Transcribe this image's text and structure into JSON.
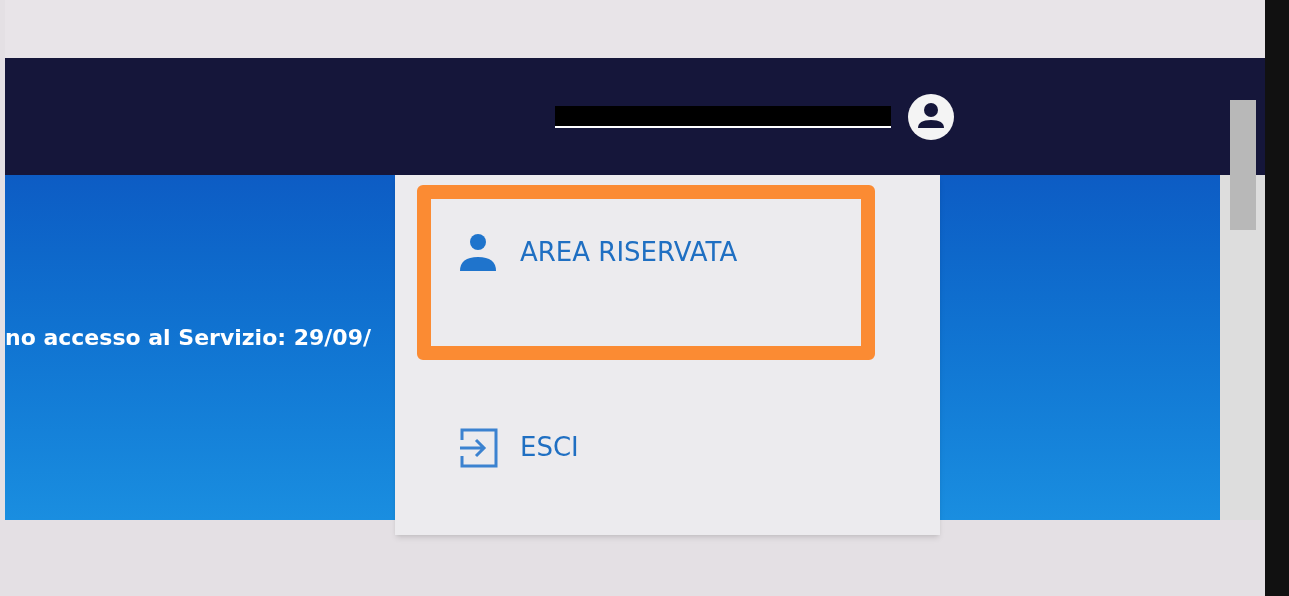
{
  "header": {
    "user_name": {
      "redacted": true
    }
  },
  "banner": {
    "last_access": "no accesso al Servizio:  29/09/"
  },
  "user_menu": {
    "open": true,
    "items": [
      {
        "kind": "profile",
        "label": "AREA RISERVATA",
        "highlighted": true
      },
      {
        "kind": "logout",
        "label": "ESCI",
        "highlighted": false
      }
    ]
  }
}
